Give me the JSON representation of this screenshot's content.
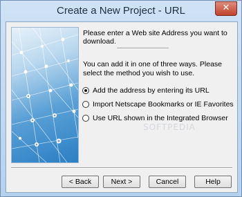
{
  "window": {
    "title": "Create a New Project - URL",
    "close_label": "✕"
  },
  "content": {
    "intro": "Please enter a Web site Address you want to download.",
    "description": "You can add it in one of three ways. Please select the method you wish to use.",
    "options": [
      {
        "label": "Add the address by entering its URL",
        "checked": true
      },
      {
        "label": "Import Netscape Bookmarks or IE Favorites",
        "checked": false
      },
      {
        "label": "Use URL shown in the Integrated Browser",
        "checked": false
      }
    ]
  },
  "buttons": {
    "back": "< Back",
    "next": "Next >",
    "cancel": "Cancel",
    "help": "Help"
  },
  "watermark": "SOFTPEDIA",
  "colors": {
    "title_bar": "#bcd6ef",
    "close_button": "#c0422e",
    "dialog_background": "#f0f0f0"
  }
}
